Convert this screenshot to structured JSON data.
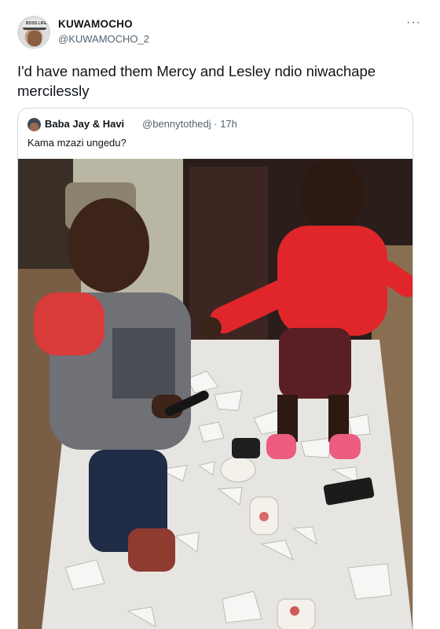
{
  "tweet": {
    "display_name": "KUWAMOCHO",
    "handle": "@KUWAMOCHO_2",
    "more_icon": "more-horizontal-icon",
    "text": "I'd have named them Mercy and Lesley ndio niwachape mercilessly",
    "avatar_cap_text": "BOSS LIFE"
  },
  "quoted": {
    "display_name": "Baba Jay & Havi",
    "handle_time": "@bennytothedj · 17h",
    "text": "Kama mzazi ungedu?"
  },
  "photo": {
    "description_icon": "photo-two-toddlers-broken-plates"
  },
  "colors": {
    "text_primary": "#0f1419",
    "text_secondary": "#536471",
    "border": "#cfd9de"
  }
}
